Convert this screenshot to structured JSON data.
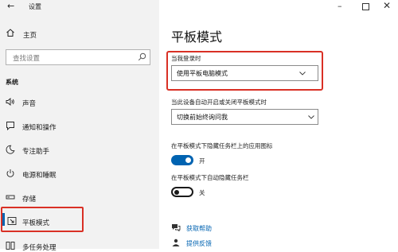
{
  "window": {
    "title": "设置",
    "minimize_glyph": "–",
    "close_glyph": "✕"
  },
  "sidebar": {
    "back_glyph": "←",
    "home_label": "主页",
    "search_placeholder": "查找设置",
    "section_label": "系统",
    "items": [
      {
        "label": "声音",
        "icon": "speaker-icon"
      },
      {
        "label": "通知和操作",
        "icon": "notification-icon"
      },
      {
        "label": "专注助手",
        "icon": "moon-icon"
      },
      {
        "label": "电源和睡眠",
        "icon": "power-icon"
      },
      {
        "label": "存储",
        "icon": "storage-icon"
      },
      {
        "label": "平板模式",
        "icon": "tablet-icon",
        "selected": true
      },
      {
        "label": "多任务处理",
        "icon": "multitask-icon"
      }
    ]
  },
  "main": {
    "title": "平板模式",
    "signin_label": "当我登录时",
    "signin_value": "使用平板电脑模式",
    "autoswitch_label": "当此设备自动开启或关闭平板模式时",
    "autoswitch_value": "切换前始终询问我",
    "hide_icons_label": "在平板模式下隐藏任务栏上的应用图标",
    "hide_icons_state": "开",
    "autohide_label": "在平板模式下自动隐藏任务栏",
    "autohide_state": "关",
    "help_link": "获取帮助",
    "feedback_link": "提供反馈"
  },
  "colors": {
    "accent": "#0063b1",
    "highlight_box": "#d93025",
    "sidebar_bg": "#f2f2f2"
  }
}
